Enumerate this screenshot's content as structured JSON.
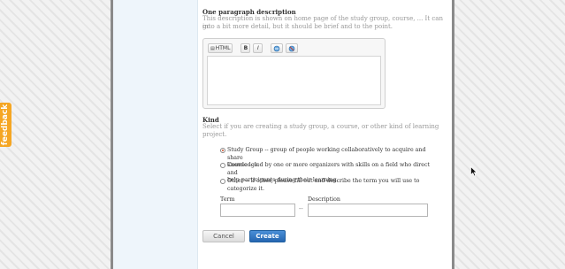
{
  "feedback": {
    "label": "feedback"
  },
  "description": {
    "label": "One paragraph description",
    "help_line1": "This description is shown on home page of the study group, course, ... It can go",
    "help_line2": "into a bit more detail, but it should be brief and to the point."
  },
  "editor": {
    "toolbar": {
      "html": "HTML",
      "bold": "B",
      "italic": "I"
    },
    "icons": [
      "link-icon",
      "unlink-icon"
    ]
  },
  "kind": {
    "label": "Kind",
    "help_line1": "Select if you are creating a study group, a course, or other kind of learning",
    "help_line2": "project.",
    "options": [
      {
        "line1": "Study Group -- group of people working collaboratively to acquire and share",
        "line2": "knowledge.",
        "checked": true
      },
      {
        "line1": "Course -- led by one or more organizers with skills on a field who direct and",
        "line2": "help participants during their learning.",
        "checked": false
      },
      {
        "line1": "Other -- if other, please fill out and describe the term you will use to",
        "line2": "categorize it.",
        "checked": false
      }
    ],
    "term_label": "Term",
    "description_label": "Description",
    "term_value": "",
    "description_value": "",
    "separator": "--"
  },
  "buttons": {
    "cancel": "Cancel",
    "create": "Create"
  },
  "colors": {
    "accent": "#2566b0",
    "feedback": "#f5a623",
    "sidebar": "#eef5fb"
  }
}
